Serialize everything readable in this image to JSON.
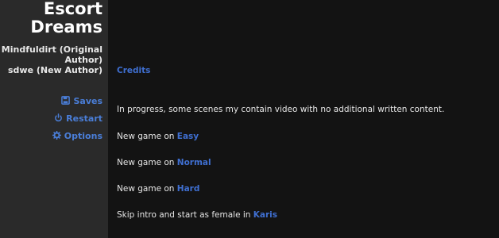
{
  "sidebar": {
    "title_line1": "Escort",
    "title_line2": "Dreams",
    "author1_line1": "Mindfuldirt (Original",
    "author1_line2": "Author)",
    "author2": "sdwe (New Author)",
    "menu": {
      "saves": {
        "label": "Saves",
        "icon": "save-icon"
      },
      "restart": {
        "label": "Restart",
        "icon": "restart-icon"
      },
      "options": {
        "label": "Options",
        "icon": "gear-icon"
      }
    }
  },
  "main": {
    "credits_link": "Credits",
    "notice": "In progress, some scenes my contain video with no additional written content.",
    "newgame_prefix": "New game on ",
    "easy": "Easy",
    "normal": "Normal",
    "hard": "Hard",
    "skip_prefix": "Skip intro and start as female in ",
    "karis": "Karis"
  },
  "colors": {
    "sidebar_bg": "#2a2a2a",
    "main_bg": "#131313",
    "link": "#3f6fd1"
  }
}
